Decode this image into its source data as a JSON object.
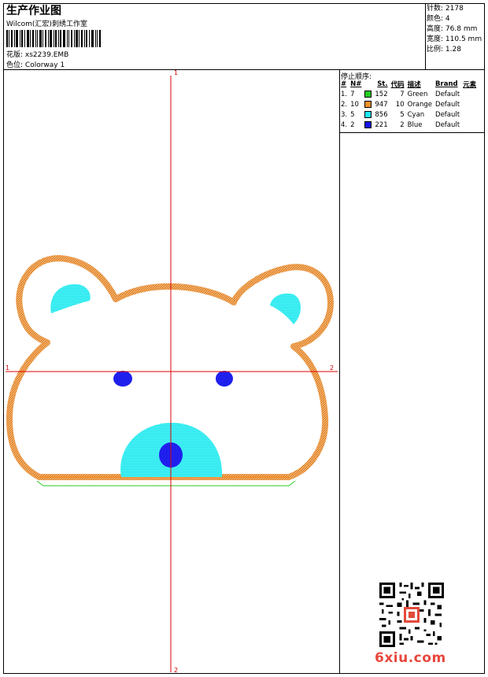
{
  "header": {
    "title": "生产作业图",
    "studio": "Wilcom(汇宏)刺绣工作室",
    "design_label": "花版:",
    "design_file": "xs2239.EMB",
    "colorway_label": "色位:",
    "colorway": "Colorway 1"
  },
  "stats": [
    {
      "label": "针数:",
      "value": "2178"
    },
    {
      "label": "颜色:",
      "value": "4"
    },
    {
      "label": "高度:",
      "value": "76.8 mm"
    },
    {
      "label": "宽度:",
      "value": "110.5 mm"
    },
    {
      "label": "比例:",
      "value": "1.28"
    }
  ],
  "stop_sequence": {
    "title": "停止顺序:",
    "columns": [
      "#",
      "N#",
      "St.",
      "代码",
      "描述",
      "Brand",
      "元素"
    ],
    "rows": [
      {
        "index": "1.",
        "n": "7",
        "swatch": "#22cc22",
        "stitches": "152",
        "code": "7",
        "desc": "Green",
        "brand": "Default"
      },
      {
        "index": "2.",
        "n": "10",
        "swatch": "#f0902c",
        "stitches": "947",
        "code": "10",
        "desc": "Orange",
        "brand": "Default"
      },
      {
        "index": "3.",
        "n": "5",
        "swatch": "#1ee8ee",
        "stitches": "856",
        "code": "5",
        "desc": "Cyan",
        "brand": "Default"
      },
      {
        "index": "4.",
        "n": "2",
        "swatch": "#1414e6",
        "stitches": "221",
        "code": "2",
        "desc": "Blue",
        "brand": "Default"
      }
    ]
  },
  "axes": {
    "top": "1",
    "bottom": "2",
    "left": "1",
    "right": "2"
  },
  "colors": {
    "axis": "#dd0000",
    "green": "#22cc22",
    "orange": "#f0902c",
    "cyan": "#1ee8ee",
    "blue": "#1414e6"
  },
  "watermark": "6xiu.com"
}
